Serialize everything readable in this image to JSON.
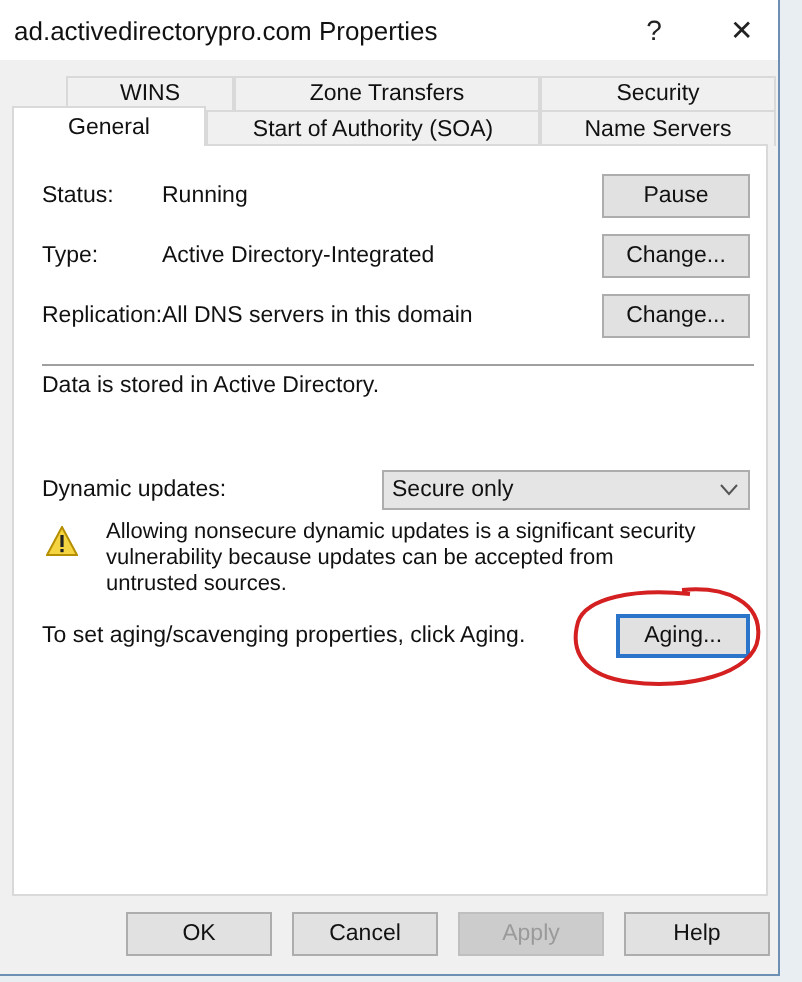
{
  "window": {
    "title": "ad.activedirectorypro.com Properties",
    "help_button": "?",
    "close_button": "✕"
  },
  "tab_rows": [
    [
      {
        "label": "WINS",
        "selected": false
      },
      {
        "label": "Zone Transfers",
        "selected": false
      },
      {
        "label": "Security",
        "selected": false
      }
    ],
    [
      {
        "label": "General",
        "selected": true
      },
      {
        "label": "Start of Authority (SOA)",
        "selected": false
      },
      {
        "label": "Name Servers",
        "selected": false
      }
    ]
  ],
  "fields": [
    {
      "label": "Status:",
      "value": "Running",
      "button": "Pause"
    },
    {
      "label": "Type:",
      "value": "Active Directory-Integrated",
      "button": "Change..."
    },
    {
      "label": "Replication:",
      "value": "All DNS servers in this domain",
      "button": "Change..."
    }
  ],
  "storage_note": "Data is stored in Active Directory.",
  "dynamic_updates": {
    "label": "Dynamic updates:",
    "value": "Secure only"
  },
  "warning": "Allowing nonsecure dynamic updates is a significant security vulnerability because updates can be accepted from untrusted sources.",
  "aging": {
    "text": "To set aging/scavenging properties, click Aging.",
    "button": "Aging...",
    "focused": true
  },
  "buttons": [
    {
      "label": "OK",
      "disabled": false
    },
    {
      "label": "Cancel",
      "disabled": false
    },
    {
      "label": "Apply",
      "disabled": true
    },
    {
      "label": "Help",
      "disabled": false
    }
  ]
}
